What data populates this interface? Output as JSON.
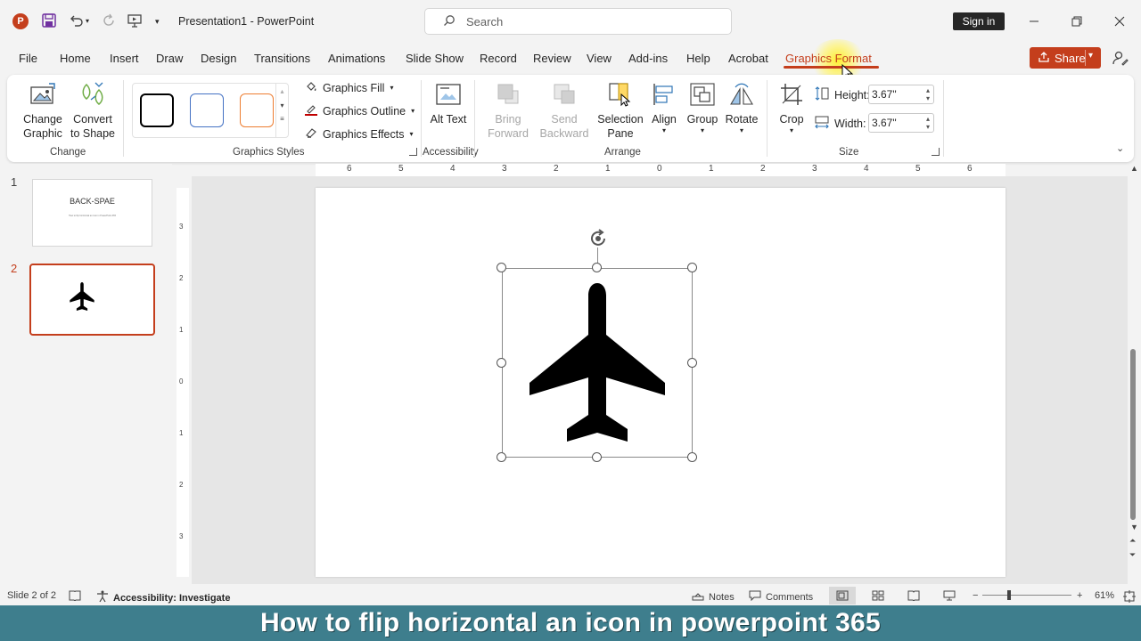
{
  "titlebar": {
    "logo_letter": "P",
    "document_title": "Presentation1  -  PowerPoint",
    "search_placeholder": "Search",
    "signin_label": "Sign in"
  },
  "tabs": [
    {
      "label": "File"
    },
    {
      "label": "Home"
    },
    {
      "label": "Insert"
    },
    {
      "label": "Draw"
    },
    {
      "label": "Design"
    },
    {
      "label": "Transitions"
    },
    {
      "label": "Animations"
    },
    {
      "label": "Slide Show"
    },
    {
      "label": "Record"
    },
    {
      "label": "Review"
    },
    {
      "label": "View"
    },
    {
      "label": "Add-ins"
    },
    {
      "label": "Help"
    },
    {
      "label": "Acrobat"
    },
    {
      "label": "Graphics Format",
      "active": true
    }
  ],
  "share_label": "Share",
  "ribbon": {
    "change": {
      "change_graphic": "Change Graphic",
      "convert_to_shape": "Convert to Shape",
      "label": "Change"
    },
    "styles": {
      "fill": "Graphics Fill",
      "outline": "Graphics Outline",
      "effects": "Graphics Effects",
      "label": "Graphics Styles",
      "swatch_colors": [
        "#000000",
        "#4472c4",
        "#ed7d31"
      ]
    },
    "accessibility": {
      "alt_text": "Alt Text",
      "label": "Accessibility"
    },
    "arrange": {
      "bring_forward": "Bring Forward",
      "send_backward": "Send Backward",
      "selection_pane": "Selection Pane",
      "align": "Align",
      "group": "Group",
      "rotate": "Rotate",
      "label": "Arrange"
    },
    "size": {
      "crop": "Crop",
      "height_label": "Height:",
      "height_value": "3.67\"",
      "width_label": "Width:",
      "width_value": "3.67\"",
      "label": "Size"
    }
  },
  "ruler": {
    "horizontal": [
      "6",
      "5",
      "4",
      "3",
      "2",
      "1",
      "0",
      "1",
      "2",
      "3",
      "4",
      "5",
      "6"
    ],
    "vertical": [
      "3",
      "2",
      "1",
      "0",
      "1",
      "2",
      "3"
    ]
  },
  "slides": [
    {
      "number": "1",
      "title": "BACK-SPAE",
      "subtitle": "How to flip horizontal an icon in PowerPoint 365"
    },
    {
      "number": "2",
      "selected": true
    }
  ],
  "statusbar": {
    "slide_info": "Slide 2 of 2",
    "accessibility": "Accessibility: Investigate",
    "notes": "Notes",
    "comments": "Comments",
    "zoom": "61%"
  },
  "caption": "How to flip horizontal an icon in powerpoint 365",
  "colors": {
    "accent": "#c43e1c",
    "caption_bg": "#3e7e8d"
  }
}
